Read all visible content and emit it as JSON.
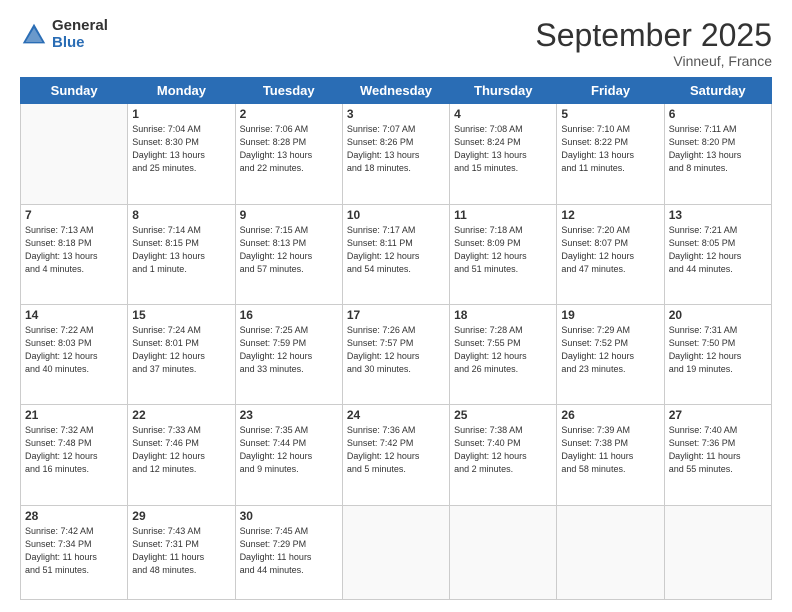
{
  "logo": {
    "general": "General",
    "blue": "Blue"
  },
  "header": {
    "month": "September 2025",
    "location": "Vinneuf, France"
  },
  "days": [
    "Sunday",
    "Monday",
    "Tuesday",
    "Wednesday",
    "Thursday",
    "Friday",
    "Saturday"
  ],
  "weeks": [
    [
      {
        "num": "",
        "info": ""
      },
      {
        "num": "1",
        "info": "Sunrise: 7:04 AM\nSunset: 8:30 PM\nDaylight: 13 hours\nand 25 minutes."
      },
      {
        "num": "2",
        "info": "Sunrise: 7:06 AM\nSunset: 8:28 PM\nDaylight: 13 hours\nand 22 minutes."
      },
      {
        "num": "3",
        "info": "Sunrise: 7:07 AM\nSunset: 8:26 PM\nDaylight: 13 hours\nand 18 minutes."
      },
      {
        "num": "4",
        "info": "Sunrise: 7:08 AM\nSunset: 8:24 PM\nDaylight: 13 hours\nand 15 minutes."
      },
      {
        "num": "5",
        "info": "Sunrise: 7:10 AM\nSunset: 8:22 PM\nDaylight: 13 hours\nand 11 minutes."
      },
      {
        "num": "6",
        "info": "Sunrise: 7:11 AM\nSunset: 8:20 PM\nDaylight: 13 hours\nand 8 minutes."
      }
    ],
    [
      {
        "num": "7",
        "info": "Sunrise: 7:13 AM\nSunset: 8:18 PM\nDaylight: 13 hours\nand 4 minutes."
      },
      {
        "num": "8",
        "info": "Sunrise: 7:14 AM\nSunset: 8:15 PM\nDaylight: 13 hours\nand 1 minute."
      },
      {
        "num": "9",
        "info": "Sunrise: 7:15 AM\nSunset: 8:13 PM\nDaylight: 12 hours\nand 57 minutes."
      },
      {
        "num": "10",
        "info": "Sunrise: 7:17 AM\nSunset: 8:11 PM\nDaylight: 12 hours\nand 54 minutes."
      },
      {
        "num": "11",
        "info": "Sunrise: 7:18 AM\nSunset: 8:09 PM\nDaylight: 12 hours\nand 51 minutes."
      },
      {
        "num": "12",
        "info": "Sunrise: 7:20 AM\nSunset: 8:07 PM\nDaylight: 12 hours\nand 47 minutes."
      },
      {
        "num": "13",
        "info": "Sunrise: 7:21 AM\nSunset: 8:05 PM\nDaylight: 12 hours\nand 44 minutes."
      }
    ],
    [
      {
        "num": "14",
        "info": "Sunrise: 7:22 AM\nSunset: 8:03 PM\nDaylight: 12 hours\nand 40 minutes."
      },
      {
        "num": "15",
        "info": "Sunrise: 7:24 AM\nSunset: 8:01 PM\nDaylight: 12 hours\nand 37 minutes."
      },
      {
        "num": "16",
        "info": "Sunrise: 7:25 AM\nSunset: 7:59 PM\nDaylight: 12 hours\nand 33 minutes."
      },
      {
        "num": "17",
        "info": "Sunrise: 7:26 AM\nSunset: 7:57 PM\nDaylight: 12 hours\nand 30 minutes."
      },
      {
        "num": "18",
        "info": "Sunrise: 7:28 AM\nSunset: 7:55 PM\nDaylight: 12 hours\nand 26 minutes."
      },
      {
        "num": "19",
        "info": "Sunrise: 7:29 AM\nSunset: 7:52 PM\nDaylight: 12 hours\nand 23 minutes."
      },
      {
        "num": "20",
        "info": "Sunrise: 7:31 AM\nSunset: 7:50 PM\nDaylight: 12 hours\nand 19 minutes."
      }
    ],
    [
      {
        "num": "21",
        "info": "Sunrise: 7:32 AM\nSunset: 7:48 PM\nDaylight: 12 hours\nand 16 minutes."
      },
      {
        "num": "22",
        "info": "Sunrise: 7:33 AM\nSunset: 7:46 PM\nDaylight: 12 hours\nand 12 minutes."
      },
      {
        "num": "23",
        "info": "Sunrise: 7:35 AM\nSunset: 7:44 PM\nDaylight: 12 hours\nand 9 minutes."
      },
      {
        "num": "24",
        "info": "Sunrise: 7:36 AM\nSunset: 7:42 PM\nDaylight: 12 hours\nand 5 minutes."
      },
      {
        "num": "25",
        "info": "Sunrise: 7:38 AM\nSunset: 7:40 PM\nDaylight: 12 hours\nand 2 minutes."
      },
      {
        "num": "26",
        "info": "Sunrise: 7:39 AM\nSunset: 7:38 PM\nDaylight: 11 hours\nand 58 minutes."
      },
      {
        "num": "27",
        "info": "Sunrise: 7:40 AM\nSunset: 7:36 PM\nDaylight: 11 hours\nand 55 minutes."
      }
    ],
    [
      {
        "num": "28",
        "info": "Sunrise: 7:42 AM\nSunset: 7:34 PM\nDaylight: 11 hours\nand 51 minutes."
      },
      {
        "num": "29",
        "info": "Sunrise: 7:43 AM\nSunset: 7:31 PM\nDaylight: 11 hours\nand 48 minutes."
      },
      {
        "num": "30",
        "info": "Sunrise: 7:45 AM\nSunset: 7:29 PM\nDaylight: 11 hours\nand 44 minutes."
      },
      {
        "num": "",
        "info": ""
      },
      {
        "num": "",
        "info": ""
      },
      {
        "num": "",
        "info": ""
      },
      {
        "num": "",
        "info": ""
      }
    ]
  ]
}
